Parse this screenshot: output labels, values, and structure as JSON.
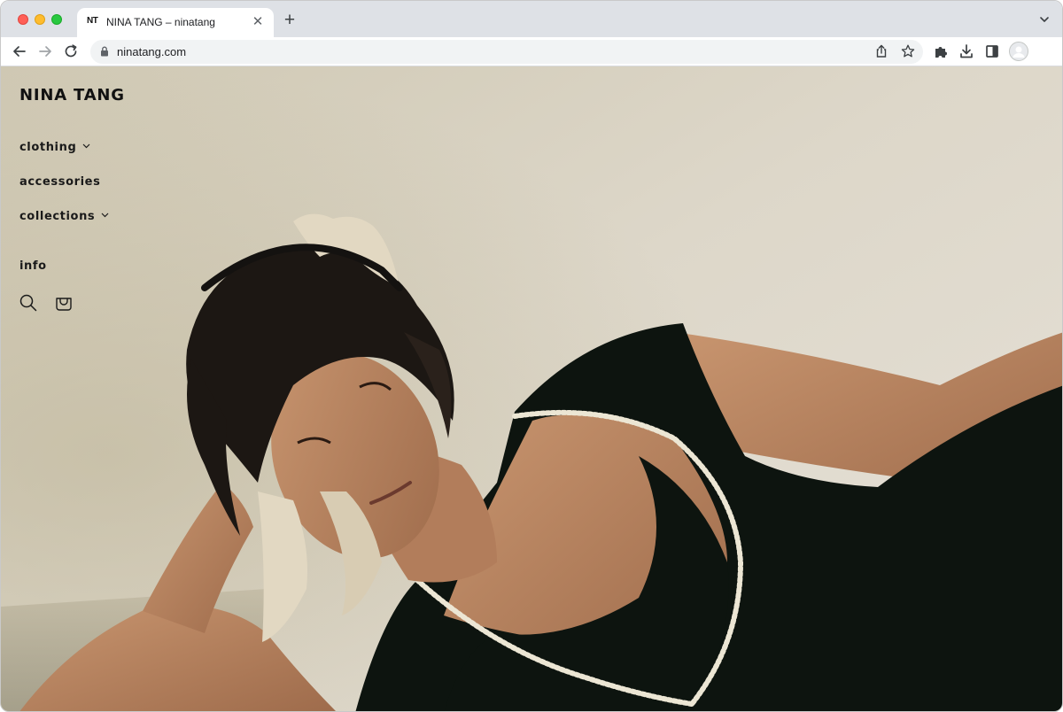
{
  "browser": {
    "tab": {
      "favicon": "NT",
      "title": "NINA TANG – ninatang"
    },
    "url": "ninatang.com",
    "icons": {
      "back": "back-arrow-icon",
      "forward": "forward-arrow-icon",
      "reload": "reload-icon",
      "lock": "lock-icon",
      "share": "share-icon",
      "bookmark": "star-icon",
      "extensions": "puzzle-icon",
      "downloads": "download-icon",
      "sidepanel": "side-panel-icon",
      "profile": "profile-icon",
      "close": "close-icon",
      "new_tab": "plus-icon",
      "tab_menu": "chevron-down-icon"
    }
  },
  "site": {
    "brand": "NINA TANG",
    "nav": [
      {
        "label": "clothing",
        "has_menu": true
      },
      {
        "label": "accessories",
        "has_menu": false
      },
      {
        "label": "collections",
        "has_menu": true
      },
      {
        "label": "info",
        "has_menu": false
      }
    ],
    "icons": {
      "search": "search-icon",
      "cart": "cart-icon"
    }
  },
  "colors": {
    "text": "#111111",
    "backdrop": "#d3ccbb",
    "dress": "#0d140f",
    "skin": "#b8835f"
  }
}
